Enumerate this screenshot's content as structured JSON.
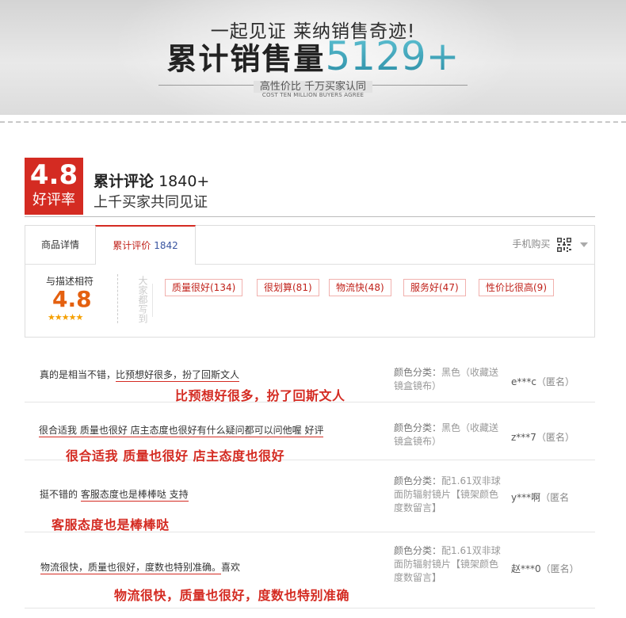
{
  "banner": {
    "tagline": "一起见证 莱纳销售奇迹!",
    "headline_label": "累计销售量",
    "headline_number": "5129+",
    "subtitle": "高性价比 千万买家认同",
    "subtitle_en": "COST TEN MILLION BUYERS AGREE"
  },
  "rating": {
    "score": "4.8",
    "label": "好评率",
    "title": "累计评论",
    "title_count": "1840+",
    "subtitle": "上千买家共同见证"
  },
  "tabs": {
    "details": "商品详情",
    "reviews": "累计评价",
    "reviews_count": "1842",
    "mobile_buy": "手机购买"
  },
  "score_panel": {
    "match_label": "与描述相符",
    "match_score": "4.8",
    "stars": "★★★★★",
    "everyone_says": "大家都写到",
    "tags": [
      "质量很好(134)",
      "很划算(81)",
      "物流快(48)",
      "服务好(47)",
      "性价比很高(9)"
    ]
  },
  "reviews": [
    {
      "text_plain": "真的是相当不错，",
      "text_marked": "比预想好很多，扮了回斯文人",
      "annotation": "比预想好很多，扮了回斯文人",
      "meta_key": "颜色分类：",
      "meta_value": "黑色（收藏送镜盒镜布）",
      "user": "e***c",
      "anon": "（匿名）"
    },
    {
      "text_plain": "",
      "text_marked": "很合适我 质量也很好  店主态度也很好有什么疑问都可以问他喔 好评",
      "annotation": "很合适我 质量也很好 店主态度也很好",
      "meta_key": "颜色分类：",
      "meta_value": "黑色（收藏送镜盒镜布）",
      "user": "z***7",
      "anon": "（匿名）"
    },
    {
      "text_plain": "挺不错的 ",
      "text_marked": "客服态度也是棒棒哒 支持",
      "annotation": "客服态度也是棒棒哒",
      "meta_key": "颜色分类：",
      "meta_value": "配1.61双非球面防辐射镜片【镜架颜色度数留言】",
      "user": "y***啊",
      "anon": "（匿名"
    },
    {
      "text_plain": "",
      "text_marked": "物流很快，质量也很好，度数也特别准确。",
      "text_tail": "喜欢",
      "annotation": "物流很快，质量也很好，度数也特别准确",
      "meta_key": "颜色分类：",
      "meta_value": "配1.61双非球面防辐射镜片【镜架颜色度数留言】",
      "user": "赵***0",
      "anon": "（匿名）"
    }
  ]
}
